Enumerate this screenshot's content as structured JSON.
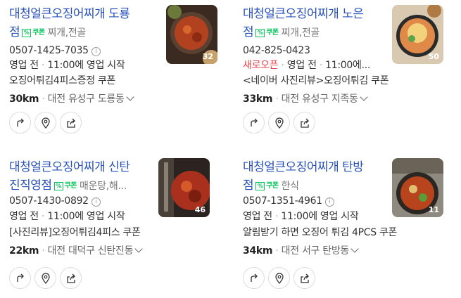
{
  "results": [
    {
      "title_line1": "대청얼큰오징어찌개 도룡",
      "title_line2": "점",
      "coupon_label": "쿠폰",
      "category": "찌개,전골",
      "phone": "0507-1425-7035",
      "status": "영업 전",
      "hours": "11:00에 영업 시작",
      "promo": "오징어튀김4피스증정 쿠폰",
      "distance": "30km",
      "address": "대전 유성구 도룡동",
      "photo_count": "32"
    },
    {
      "title_line1": "대청얼큰오징어찌개 노은",
      "title_line2": "점",
      "coupon_label": "쿠폰",
      "category": "찌개,전골",
      "phone": "042-825-0423",
      "new_label": "새로오픈",
      "status": "영업 전",
      "hours": "11:00에...",
      "promo": "<네이버 사진리뷰>오징어튀김 쿠폰",
      "distance": "33km",
      "address": "대전 유성구 지족동",
      "photo_count": "50"
    },
    {
      "title_line1": "대청얼큰오징어찌개 신탄",
      "title_line2": "진직영점",
      "coupon_label": "쿠폰",
      "category": "매운탕,해...",
      "phone": "0507-1430-0892",
      "status": "영업 전",
      "hours": "11:00에 영업 시작",
      "promo": "[사진리뷰]오징어튀김4피스 쿠폰",
      "distance": "22km",
      "address": "대전 대덕구 신탄진동",
      "photo_count": "46"
    },
    {
      "title_line1": "대청얼큰오징어찌개 탄방",
      "title_line2": "점",
      "coupon_label": "쿠폰",
      "category": "한식",
      "phone": "0507-1351-4961",
      "status": "영업 전",
      "hours": "11:00에 영업 시작",
      "promo": "알림받기 하면 오징어 튀김 4PCS 쿠폰",
      "distance": "34km",
      "address": "대전 서구 탄방동",
      "photo_count": "11"
    }
  ],
  "icons": [
    "directions-icon",
    "location-pin-icon",
    "share-icon",
    "info-icon",
    "coupon-icon",
    "chevron-down-icon"
  ],
  "colors": {
    "title": "#2a52be",
    "coupon": "#03c75a",
    "new_open": "#e8424b"
  }
}
